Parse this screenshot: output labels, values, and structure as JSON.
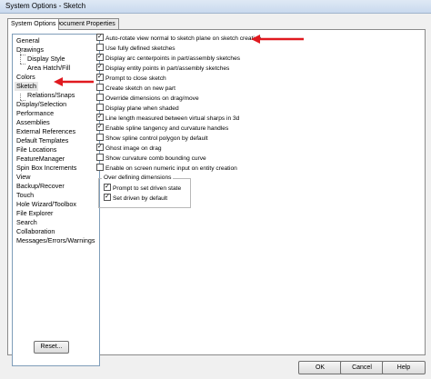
{
  "window": {
    "title": "System Options - Sketch"
  },
  "tabs": [
    {
      "label": "System Options"
    },
    {
      "label": "Document Properties"
    }
  ],
  "tree": {
    "items": [
      {
        "label": "General"
      },
      {
        "label": "Drawings"
      },
      {
        "label": "Display Style"
      },
      {
        "label": "Area Hatch/Fill"
      },
      {
        "label": "Colors"
      },
      {
        "label": "Sketch"
      },
      {
        "label": "Relations/Snaps"
      },
      {
        "label": "Display/Selection"
      },
      {
        "label": "Performance"
      },
      {
        "label": "Assemblies"
      },
      {
        "label": "External References"
      },
      {
        "label": "Default Templates"
      },
      {
        "label": "File Locations"
      },
      {
        "label": "FeatureManager"
      },
      {
        "label": "Spin Box Increments"
      },
      {
        "label": "View"
      },
      {
        "label": "Backup/Recover"
      },
      {
        "label": "Touch"
      },
      {
        "label": "Hole Wizard/Toolbox"
      },
      {
        "label": "File Explorer"
      },
      {
        "label": "Search"
      },
      {
        "label": "Collaboration"
      },
      {
        "label": "Messages/Errors/Warnings"
      }
    ],
    "selected": "Sketch"
  },
  "options": [
    {
      "label": "Auto-rotate view normal to sketch plane on sketch creation",
      "checked": true
    },
    {
      "label": "Use fully defined sketches",
      "checked": false
    },
    {
      "label": "Display arc centerpoints in part/assembly sketches",
      "checked": true
    },
    {
      "label": "Display entity points in part/assembly sketches",
      "checked": true
    },
    {
      "label": "Prompt to close sketch",
      "checked": true
    },
    {
      "label": "Create sketch on new part",
      "checked": false
    },
    {
      "label": "Override dimensions on drag/move",
      "checked": false
    },
    {
      "label": "Display plane when shaded",
      "checked": false
    },
    {
      "label": "Line length measured between virtual sharps in 3d",
      "checked": true
    },
    {
      "label": "Enable spline tangency and curvature handles",
      "checked": true
    },
    {
      "label": "Show spline control polygon by default",
      "checked": false
    },
    {
      "label": "Ghost image on drag",
      "checked": true
    },
    {
      "label": "Show curvature comb bounding curve",
      "checked": false
    },
    {
      "label": "Enable on screen numeric input on entity creation",
      "checked": false
    }
  ],
  "overdefining": {
    "title": "Over defining dimensions",
    "options": [
      {
        "label": "Prompt to set driven state",
        "checked": true
      },
      {
        "label": "Set driven by default",
        "checked": true
      }
    ]
  },
  "buttons": {
    "reset": "Reset...",
    "ok": "OK",
    "cancel": "Cancel",
    "help": "Help"
  },
  "colors": {
    "arrow": "#e0191f",
    "selection": "#e6e6e6"
  }
}
